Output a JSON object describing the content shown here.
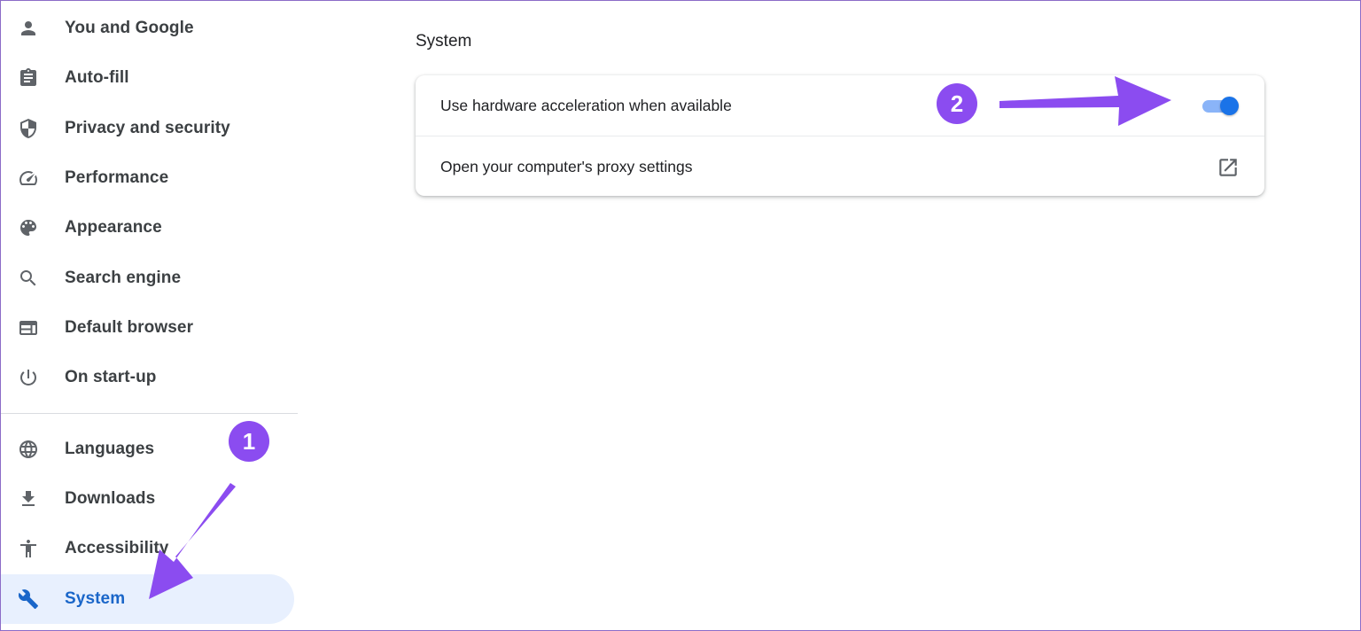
{
  "sidebar": {
    "items": [
      {
        "label": "You and Google",
        "icon": "person-icon"
      },
      {
        "label": "Auto-fill",
        "icon": "clipboard-icon"
      },
      {
        "label": "Privacy and security",
        "icon": "shield-icon"
      },
      {
        "label": "Performance",
        "icon": "speedometer-icon"
      },
      {
        "label": "Appearance",
        "icon": "palette-icon"
      },
      {
        "label": "Search engine",
        "icon": "search-icon"
      },
      {
        "label": "Default browser",
        "icon": "browser-window-icon"
      },
      {
        "label": "On start-up",
        "icon": "power-icon"
      },
      {
        "label": "Languages",
        "icon": "globe-icon"
      },
      {
        "label": "Downloads",
        "icon": "download-icon"
      },
      {
        "label": "Accessibility",
        "icon": "accessibility-icon"
      },
      {
        "label": "System",
        "icon": "wrench-icon",
        "active": true
      }
    ]
  },
  "main": {
    "section_title": "System",
    "rows": [
      {
        "label": "Use hardware acceleration when available",
        "control": "toggle",
        "enabled": true
      },
      {
        "label": "Open your computer's proxy settings",
        "control": "external-link-icon"
      }
    ]
  },
  "annotations": {
    "step1": "1",
    "step2": "2",
    "color": "#8b4cf0"
  },
  "colors": {
    "accent": "#1a73e8",
    "active_bg": "#e8f0fe",
    "toggle_track": "#8ab4f8"
  }
}
